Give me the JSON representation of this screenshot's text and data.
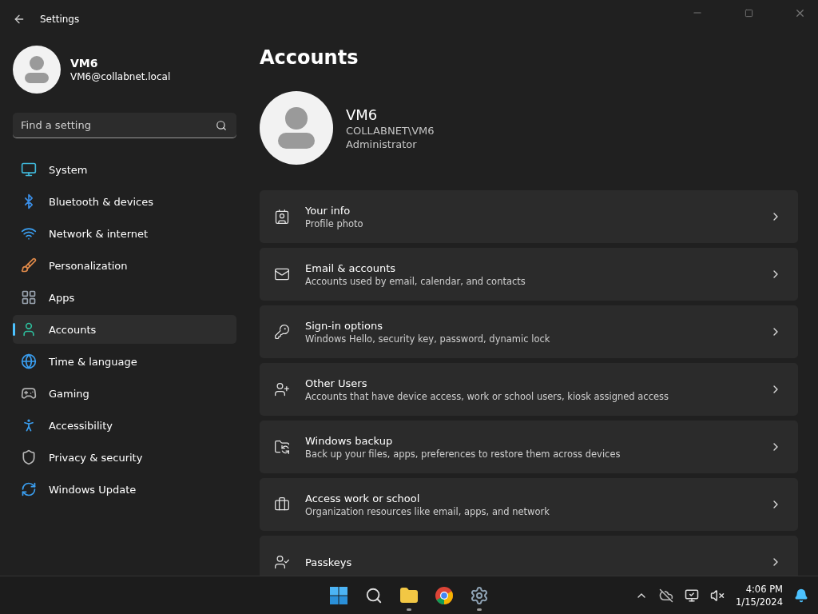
{
  "window": {
    "title": "Settings"
  },
  "user": {
    "name": "VM6",
    "email": "VM6@collabnet.local"
  },
  "search": {
    "placeholder": "Find a setting"
  },
  "sidebar": {
    "items": [
      {
        "label": "System",
        "selected": false
      },
      {
        "label": "Bluetooth & devices",
        "selected": false
      },
      {
        "label": "Network & internet",
        "selected": false
      },
      {
        "label": "Personalization",
        "selected": false
      },
      {
        "label": "Apps",
        "selected": false
      },
      {
        "label": "Accounts",
        "selected": true
      },
      {
        "label": "Time & language",
        "selected": false
      },
      {
        "label": "Gaming",
        "selected": false
      },
      {
        "label": "Accessibility",
        "selected": false
      },
      {
        "label": "Privacy & security",
        "selected": false
      },
      {
        "label": "Windows Update",
        "selected": false
      }
    ]
  },
  "page": {
    "title": "Accounts",
    "account": {
      "name": "VM6",
      "domain": "COLLABNET\\VM6",
      "role": "Administrator"
    },
    "cards": [
      {
        "title": "Your info",
        "subtitle": "Profile photo"
      },
      {
        "title": "Email & accounts",
        "subtitle": "Accounts used by email, calendar, and contacts"
      },
      {
        "title": "Sign-in options",
        "subtitle": "Windows Hello, security key, password, dynamic lock"
      },
      {
        "title": "Other Users",
        "subtitle": "Accounts that have device access, work or school users, kiosk assigned access"
      },
      {
        "title": "Windows backup",
        "subtitle": "Back up your files, apps, preferences to restore them across devices"
      },
      {
        "title": "Access work or school",
        "subtitle": "Organization resources like email, apps, and network"
      },
      {
        "title": "Passkeys"
      }
    ]
  },
  "taskbar": {
    "apps": [
      {
        "kind": "start",
        "running": false
      },
      {
        "kind": "search",
        "running": false
      },
      {
        "kind": "explorer",
        "running": true
      },
      {
        "kind": "chrome",
        "running": false
      },
      {
        "kind": "settings",
        "running": true
      }
    ],
    "time": "4:06 PM",
    "date": "1/15/2024"
  }
}
